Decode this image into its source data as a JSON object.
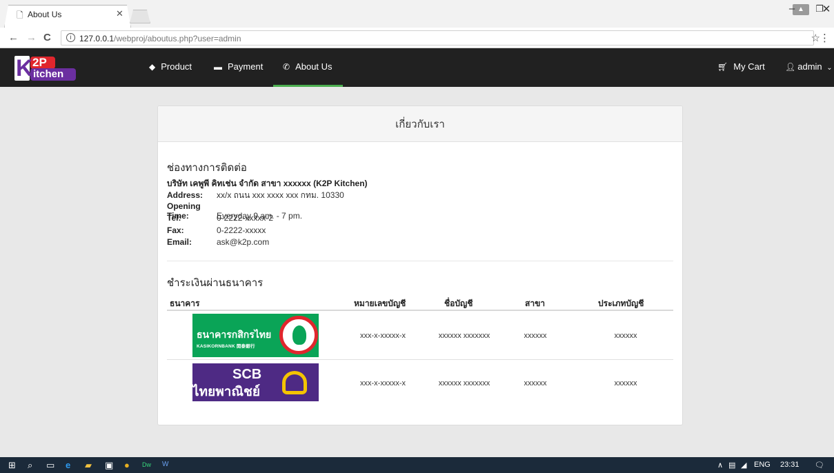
{
  "browser": {
    "tab_title": "About Us",
    "url_host": "127.0.0.1",
    "url_path": "/webproj/aboutus.php?user=admin"
  },
  "site": {
    "logo_main": "K",
    "logo_top": "2P",
    "logo_bottom": "itchen",
    "nav": {
      "product": "Product",
      "payment": "Payment",
      "about": "About Us",
      "cart": "My Cart",
      "user": "admin"
    }
  },
  "card": {
    "header": "เกี่ยวกับเรา",
    "contact_title": "ช่องทางการติดต่อ",
    "company": "บริษัท เคพูพี คิทเช่น จำกัด สาขา xxxxxx (K2P Kitchen)",
    "contact": [
      {
        "label": "Address:",
        "value": "xx/x ถนน xxx xxxx xxx กทม. 10330"
      },
      {
        "label": "Opening Time:",
        "value": "Everyday 9 am. - 7 pm."
      },
      {
        "label": "Tel:",
        "value": "0-2222-xxxxx-2"
      },
      {
        "label": "Fax:",
        "value": "0-2222-xxxxx"
      },
      {
        "label": "Email:",
        "value": "ask@k2p.com"
      }
    ],
    "bank_title": "ชำระเงินผ่านธนาคาร",
    "bank_headers": [
      "ธนาคาร",
      "หมายเลขบัญชี",
      "ชื่อบัญชี",
      "สาขา",
      "ประเภทบัญชี"
    ],
    "banks": [
      {
        "logo_line1": "ธนาคารกสิกรไทย",
        "logo_line2": "KASIKORNBANK 開泰銀行",
        "account_no": "xxx-x-xxxxx-x",
        "account_name": "xxxxxx xxxxxxx",
        "branch": "xxxxxx",
        "type": "xxxxxx"
      },
      {
        "logo_line1": "SCB",
        "logo_line2": "ไทยพาณิชย์",
        "account_no": "xxx-x-xxxxx-x",
        "account_name": "xxxxxx xxxxxxx",
        "branch": "xxxxxx",
        "type": "xxxxxx"
      }
    ]
  },
  "taskbar": {
    "lang": "ENG",
    "time": "23:31"
  },
  "colors": {
    "navbar": "#212121",
    "active": "#4caf50",
    "kbank": "#0aa457",
    "scb": "#4e2a84"
  }
}
